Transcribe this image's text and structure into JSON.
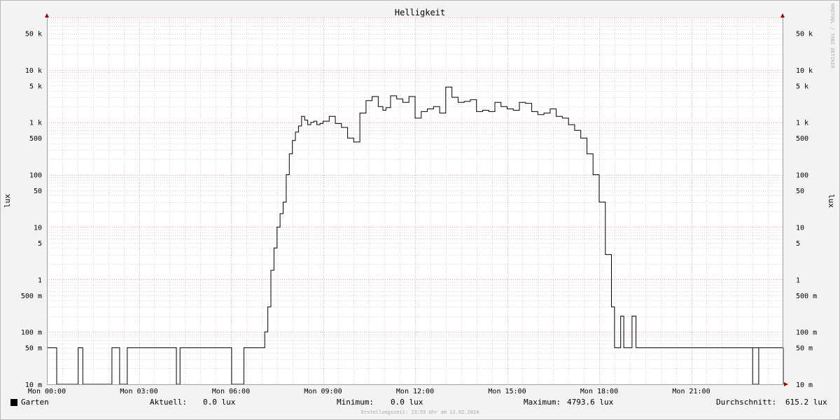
{
  "chart_data": {
    "type": "line",
    "title": "Helligkeit",
    "ylabel": "lux",
    "yscale": "log",
    "ylim": [
      0.01,
      100000
    ],
    "xlim": [
      "Mon 00:00",
      "Mon 24:00"
    ],
    "grid": true,
    "x_tick_labels": [
      "Mon 00:00",
      "Mon 03:00",
      "Mon 06:00",
      "Mon 09:00",
      "Mon 12:00",
      "Mon 15:00",
      "Mon 18:00",
      "Mon 21:00"
    ],
    "x_tick_hours": [
      0,
      3,
      6,
      9,
      12,
      15,
      18,
      21
    ],
    "y_ticks": [
      {
        "value": 0.01,
        "label": "10 m"
      },
      {
        "value": 0.05,
        "label": "50 m"
      },
      {
        "value": 0.1,
        "label": "100 m"
      },
      {
        "value": 0.5,
        "label": "500 m"
      },
      {
        "value": 1,
        "label": "1"
      },
      {
        "value": 5,
        "label": "5"
      },
      {
        "value": 10,
        "label": "10"
      },
      {
        "value": 50,
        "label": "50"
      },
      {
        "value": 100,
        "label": "100"
      },
      {
        "value": 500,
        "label": "500"
      },
      {
        "value": 1000,
        "label": "1 k"
      },
      {
        "value": 5000,
        "label": "5 k"
      },
      {
        "value": 10000,
        "label": "10 k"
      },
      {
        "value": 50000,
        "label": "50 k"
      }
    ],
    "series": [
      {
        "name": "Garten",
        "color": "#000000",
        "hours": [
          0.0,
          0.3,
          0.32,
          1.0,
          1.02,
          1.15,
          1.17,
          2.1,
          2.12,
          2.35,
          2.37,
          2.6,
          2.62,
          4.2,
          4.22,
          4.32,
          4.34,
          6.0,
          6.02,
          6.4,
          6.42,
          7.0,
          7.1,
          7.2,
          7.3,
          7.4,
          7.5,
          7.6,
          7.7,
          7.8,
          7.9,
          8.0,
          8.1,
          8.2,
          8.3,
          8.4,
          8.5,
          8.6,
          8.7,
          8.8,
          8.9,
          9.0,
          9.2,
          9.4,
          9.6,
          9.8,
          10.0,
          10.2,
          10.4,
          10.6,
          10.8,
          10.95,
          11.05,
          11.2,
          11.4,
          11.6,
          11.8,
          12.0,
          12.2,
          12.4,
          12.6,
          12.8,
          13.0,
          13.2,
          13.4,
          13.6,
          13.8,
          14.0,
          14.2,
          14.4,
          14.6,
          14.8,
          15.0,
          15.2,
          15.4,
          15.6,
          15.8,
          16.0,
          16.2,
          16.4,
          16.6,
          16.8,
          17.0,
          17.2,
          17.4,
          17.6,
          17.8,
          18.0,
          18.2,
          18.4,
          18.5,
          18.6,
          18.7,
          18.75,
          18.8,
          19.05,
          19.07,
          19.2,
          19.25,
          19.3,
          19.32,
          26.8,
          22.7,
          23.0,
          23.2,
          24.0
        ],
        "values": [
          0.05,
          0.05,
          0.01,
          0.01,
          0.05,
          0.05,
          0.01,
          0.01,
          0.05,
          0.05,
          0.01,
          0.01,
          0.05,
          0.05,
          0.01,
          0.01,
          0.05,
          0.05,
          0.01,
          0.01,
          0.05,
          0.05,
          0.1,
          0.3,
          1.5,
          4.0,
          10,
          18,
          30,
          100,
          250,
          450,
          650,
          850,
          1300,
          1100,
          900,
          1000,
          1050,
          900,
          950,
          1050,
          1300,
          950,
          800,
          500,
          420,
          1500,
          2600,
          3100,
          2000,
          1700,
          1900,
          3200,
          2800,
          2400,
          3100,
          1200,
          1600,
          1800,
          2000,
          1500,
          4700,
          3000,
          2400,
          2500,
          2700,
          1600,
          1700,
          1600,
          2400,
          2000,
          1800,
          1700,
          2400,
          2300,
          1600,
          1400,
          1500,
          1800,
          1300,
          1200,
          900,
          700,
          500,
          250,
          100,
          30,
          3,
          0.3,
          0.05,
          0.05,
          0.2,
          0.2,
          0.05,
          0.05,
          0.2,
          0.05,
          0.05,
          0.05,
          0.05,
          0.05,
          0.05,
          0.01,
          0.05,
          0.01
        ]
      }
    ]
  },
  "legend": {
    "series_name": "Garten",
    "current_label": "Aktuell:",
    "current_value": "0.0 lux",
    "min_label": "Minimum:",
    "min_value": "0.0 lux",
    "max_label": "Maximum:",
    "max_value": "4793.6 lux",
    "avg_label": "Durchschnitt:",
    "avg_value": "615.2 lux"
  },
  "watermark": "RRDTOOL / TOBI OETIKER",
  "creation_text": "Erstellungszeit: 23:55 Uhr am 12.02.2024",
  "colors": {
    "background": "#f3f3f3",
    "canvas": "#ffffff",
    "major_grid": "#e8a0a0",
    "minor_grid": "#d4d4d4",
    "axis": "#a0a0a0",
    "arrow": "#a00000",
    "line": "#000000"
  }
}
